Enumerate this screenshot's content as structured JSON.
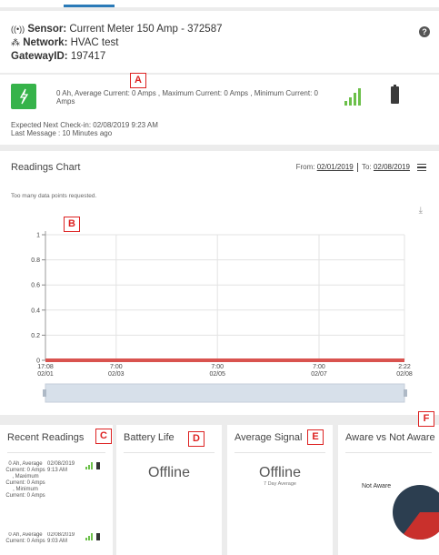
{
  "sensor": {
    "sensor_label": "Sensor:",
    "sensor_name": "Current Meter 150 Amp - 372587",
    "network_label": "Network:",
    "network_name": "HVAC test",
    "gateway_label": "GatewayID:",
    "gateway_id": "197417",
    "help_glyph": "?"
  },
  "status": {
    "reading_text": "0 Ah, Average Current: 0 Amps , Maximum Current: 0 Amps , Minimum Current: 0 Amps",
    "next_checkin": "Expected Next Check-in: 02/08/2019 9:23 AM",
    "last_message": "Last Message : 10 Minutes ago",
    "status_color": "#36b34a",
    "signal_icon": "signal-bars-icon",
    "battery_icon": "battery-icon"
  },
  "readings_chart": {
    "title": "Readings Chart",
    "from_label": "From:",
    "from_date": "02/01/2019",
    "to_label": "To:",
    "to_date": "02/08/2019",
    "notice": "Too many data points requested."
  },
  "chart_data": {
    "type": "line",
    "title": "",
    "xlabel": "",
    "ylabel": "",
    "ylim": [
      0,
      1
    ],
    "yticks": [
      "0",
      "0.2",
      "0.4",
      "0.6",
      "0.8",
      "1"
    ],
    "xticks": [
      {
        "t": 0,
        "line1": "17:08",
        "line2": "02/01"
      },
      {
        "t": 0.197,
        "line1": "7:00",
        "line2": "02/03"
      },
      {
        "t": 0.479,
        "line1": "7:00",
        "line2": "02/05"
      },
      {
        "t": 0.762,
        "line1": "7:00",
        "line2": "02/07"
      },
      {
        "t": 1,
        "line1": "2:22",
        "line2": "02/08"
      }
    ],
    "series": [
      {
        "x": [
          0,
          1
        ],
        "y": [
          0,
          0
        ],
        "color": "#d9534f"
      }
    ],
    "grid": true,
    "legend": "none"
  },
  "cards": {
    "recent_readings": {
      "title": "Recent Readings",
      "items": [
        {
          "value": "0 Ah, Average Current: 0 Amps , Maximum Current: 0 Amps , Minimum Current: 0 Amps",
          "date": "02/08/2019",
          "time": "9:13 AM"
        },
        {
          "value": "0 Ah, Average Current: 0 Amps",
          "date": "02/08/2019",
          "time": "9:03 AM"
        }
      ]
    },
    "battery_life": {
      "title": "Battery Life",
      "value": "Offline"
    },
    "average_signal": {
      "title": "Average Signal",
      "value": "Offline",
      "note": "7 Day Average"
    },
    "aware": {
      "title": "Aware vs Not Aware",
      "pie_label": "Not Aware"
    }
  },
  "annotations": [
    "A",
    "B",
    "C",
    "D",
    "E",
    "F"
  ],
  "colors": {
    "accent": "#2a7ab8",
    "annotation": "#dd2222",
    "signal_green": "#6cc04a",
    "pie_dark": "#2c3e50",
    "pie_red": "#c9302c"
  }
}
